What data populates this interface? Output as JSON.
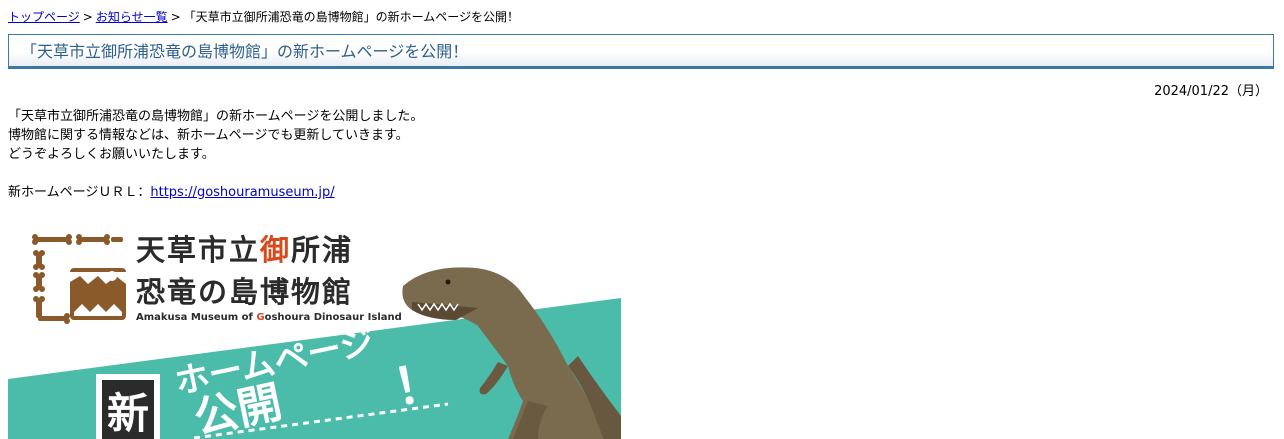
{
  "breadcrumb": {
    "items": [
      {
        "label": "トップページ"
      },
      {
        "label": "お知らせ一覧"
      }
    ],
    "separator": ">",
    "current": "「天草市立御所浦恐竜の島博物館」の新ホームページを公開！"
  },
  "page": {
    "title": "「天草市立御所浦恐竜の島博物館」の新ホームページを公開！",
    "date": "2024/01/22（月）"
  },
  "content": {
    "line1": "「天草市立御所浦恐竜の島博物館」の新ホームページを公開しました。",
    "line2": "博物館に関する情報などは、新ホームページでも更新していきます。",
    "line3": "どうぞよろしくお願いいたします。",
    "url_label": "新ホームページＵＲＬ：",
    "url_text": "https://goshouramuseum.jp/"
  },
  "banner": {
    "logo_jp_line1_a": "天草市立",
    "logo_jp_line1_accent": "御",
    "logo_jp_line1_b": "所浦",
    "logo_jp_line2": "恐竜の島博物館",
    "logo_en_a": "Amakusa Museum of ",
    "logo_en_accent": "G",
    "logo_en_b": "oshoura Dinosaur Island",
    "new_char": "新",
    "homepage_text": "ホームページ",
    "kokai_text": "公開",
    "exclaim": "！",
    "colors": {
      "teal": "#4bbbaa",
      "brown": "#8b5a2b",
      "accent": "#d64a1e",
      "dino": "#7a6a4e"
    }
  },
  "colors": {
    "link": "#0000cc",
    "title_text": "#2e5f8f",
    "title_border": "#3a78aa"
  }
}
